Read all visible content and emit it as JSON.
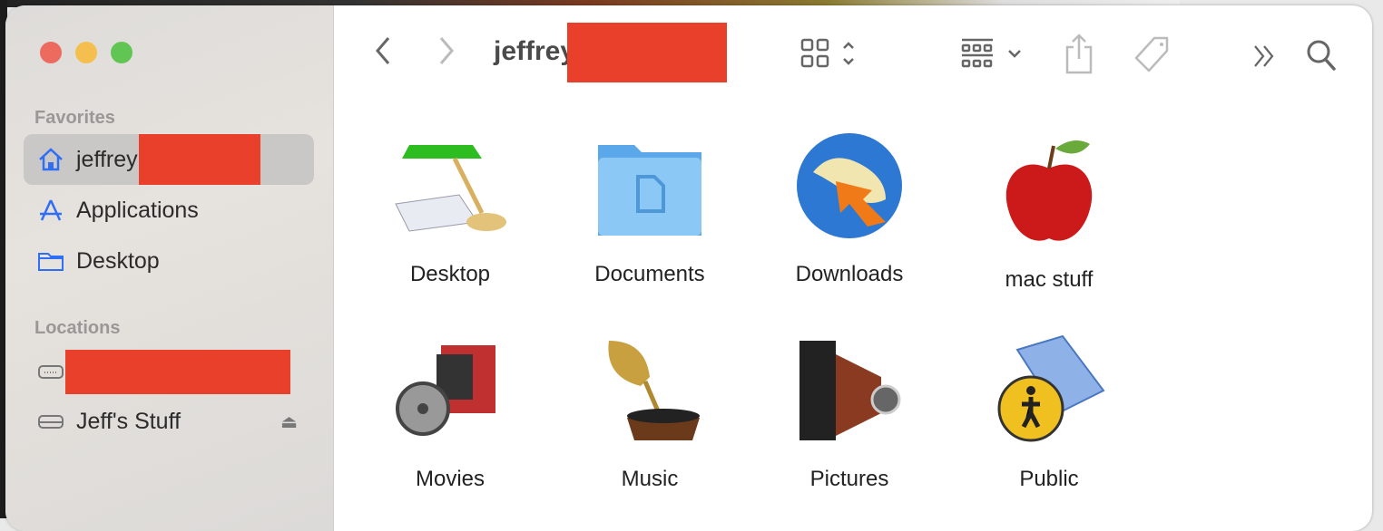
{
  "window": {
    "title": "jeffrey",
    "traffic_lights": {
      "close": "#ec6a5e",
      "minimize": "#f4bf4f",
      "zoom": "#61c554"
    }
  },
  "sidebar": {
    "favorites_label": "Favorites",
    "favorites": [
      {
        "label": "jeffrey",
        "icon": "home-icon",
        "selected": true
      },
      {
        "label": "Applications",
        "icon": "applications-icon"
      },
      {
        "label": "Desktop",
        "icon": "folder-icon"
      }
    ],
    "locations_label": "Locations",
    "locations": [
      {
        "label": "",
        "icon": "drive-icon"
      },
      {
        "label": "Jeff's Stuff",
        "icon": "drive-icon",
        "eject": true
      }
    ]
  },
  "toolbar": {
    "back": "back-icon",
    "forward": "forward-icon",
    "view": "icon-view-icon",
    "group": "group-icon",
    "share": "share-icon",
    "tag": "tag-icon",
    "more": "more-icon",
    "search": "search-icon"
  },
  "redaction_color": "#e8402a",
  "files": [
    {
      "name": "Desktop",
      "icon": "desktop-lamp-icon"
    },
    {
      "name": "Documents",
      "icon": "documents-folder-icon"
    },
    {
      "name": "Downloads",
      "icon": "downloads-globe-icon"
    },
    {
      "name": "mac stuff",
      "icon": "apple-icon"
    },
    {
      "name": "Movies",
      "icon": "movie-camera-icon"
    },
    {
      "name": "Music",
      "icon": "gramophone-icon"
    },
    {
      "name": "Pictures",
      "icon": "camera-icon"
    },
    {
      "name": "Public",
      "icon": "public-folder-icon"
    }
  ]
}
